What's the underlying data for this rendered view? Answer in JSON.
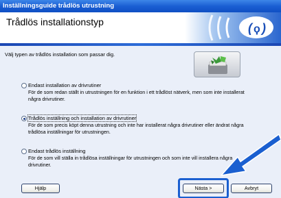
{
  "window": {
    "title": "Inställningsguide trådlös utrustning"
  },
  "header": {
    "title": "Trådlös installationstyp"
  },
  "content": {
    "instruction": "Välj typen av trådlös installation som passar dig.",
    "options": [
      {
        "label": "Endast installation av drivrutiner",
        "description": "För de som redan ställt in utrustningen för en funktion i ett trådlöst nätverk, men som inte installerat några drivrutiner.",
        "selected": false
      },
      {
        "label": "Trådlös inställning och installation av drivrutiner",
        "description": "För de som precis köpt denna utrustning och inte har installerat några drivrutiner eller ändrat några trådlösa inställningar för utrustningen.",
        "selected": true
      },
      {
        "label": "Endast trådlös inställning",
        "description": "För de som vill ställa in trådlösa inställningar för utrustningen och som inte vill installera några drivrutiner.",
        "selected": false
      }
    ]
  },
  "footer": {
    "help_label": "Hjälp",
    "next_label": "Nästa >",
    "cancel_label": "Avbryt"
  },
  "colors": {
    "titlebar": "#1a5fd3",
    "content_bg": "#eaeff9",
    "highlight": "#1a5fd0"
  },
  "icons": {
    "header_graphic": "wireless-signal-icon",
    "logo": "wireless-setup-icon",
    "pointer": "pointer-arrow-icon"
  }
}
